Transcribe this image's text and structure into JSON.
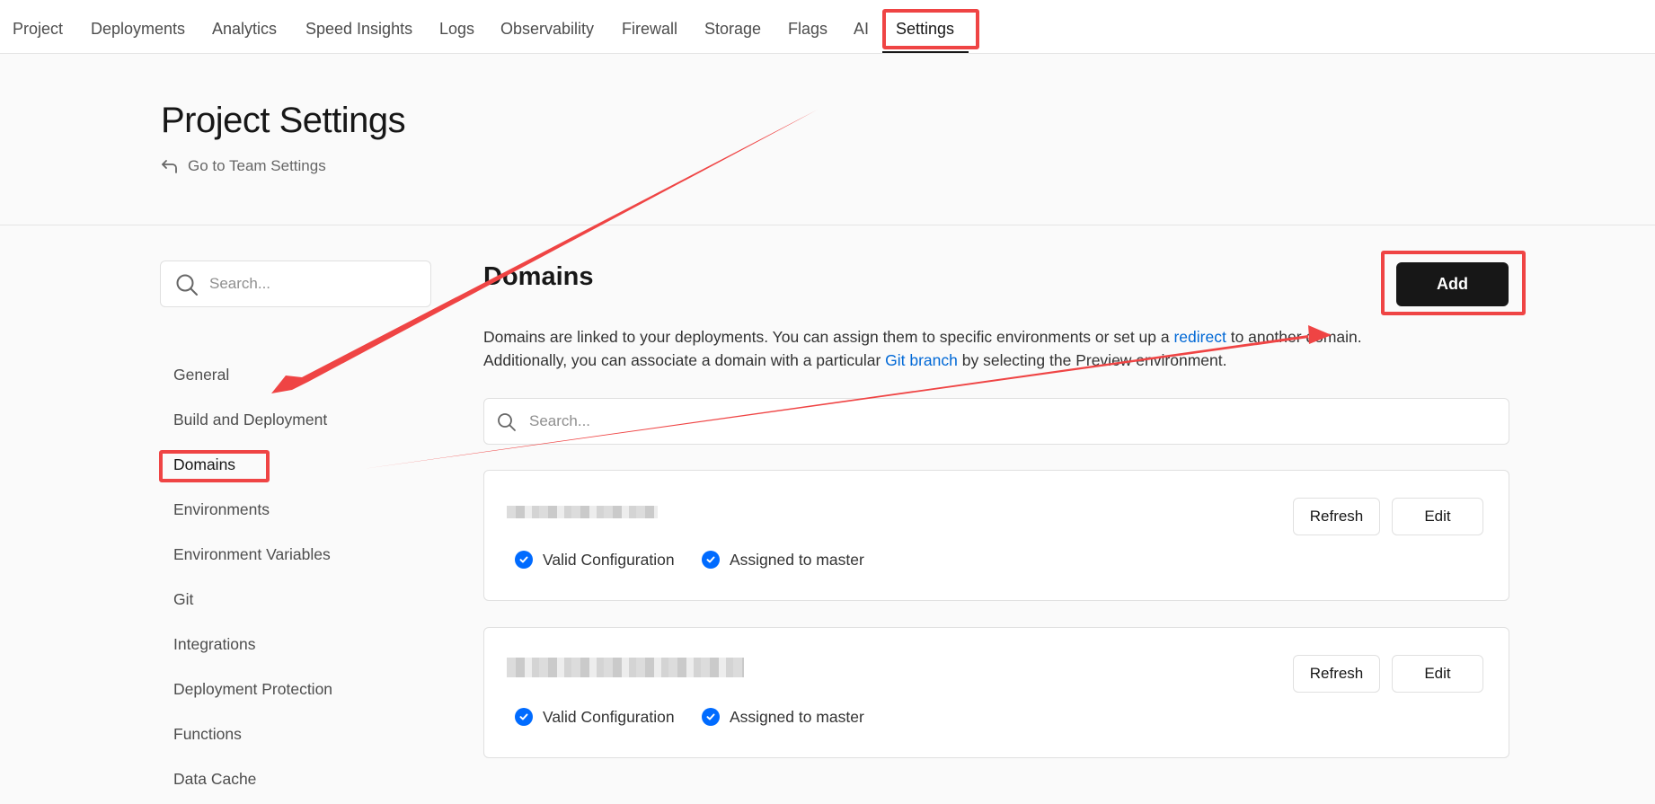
{
  "nav": {
    "tabs": [
      {
        "label": "Project"
      },
      {
        "label": "Deployments"
      },
      {
        "label": "Analytics"
      },
      {
        "label": "Speed Insights"
      },
      {
        "label": "Logs"
      },
      {
        "label": "Observability"
      },
      {
        "label": "Firewall"
      },
      {
        "label": "Storage"
      },
      {
        "label": "Flags"
      },
      {
        "label": "AI"
      },
      {
        "label": "Settings"
      }
    ],
    "active_tab": "Settings"
  },
  "header": {
    "title": "Project Settings",
    "team_link": "Go to Team Settings",
    "team_link_icon": "corner-up-left-icon"
  },
  "sidebar": {
    "search_placeholder": "Search...",
    "items": [
      {
        "label": "General"
      },
      {
        "label": "Build and Deployment"
      },
      {
        "label": "Domains"
      },
      {
        "label": "Environments"
      },
      {
        "label": "Environment Variables"
      },
      {
        "label": "Git"
      },
      {
        "label": "Integrations"
      },
      {
        "label": "Deployment Protection"
      },
      {
        "label": "Functions"
      },
      {
        "label": "Data Cache"
      }
    ],
    "active_item": "Domains"
  },
  "domains": {
    "title": "Domains",
    "add_label": "Add",
    "description": {
      "part1": "Domains are linked to your deployments. You can assign them to specific environments or set up a ",
      "link1": "redirect",
      "part2": " to another domain.",
      "part3": "Additionally, you can associate a domain with a particular ",
      "link2": "Git branch",
      "part4": " by selecting the Preview environment."
    },
    "search_placeholder": "Search...",
    "cards": [
      {
        "domain": "",
        "refresh_label": "Refresh",
        "edit_label": "Edit",
        "status_valid": "Valid Configuration",
        "status_assigned": "Assigned to master"
      },
      {
        "domain": "",
        "refresh_label": "Refresh",
        "edit_label": "Edit",
        "status_valid": "Valid Configuration",
        "status_assigned": "Assigned to master"
      }
    ]
  },
  "colors": {
    "accent": "#0068d6",
    "check": "#006bff",
    "annotation": "#ef4444",
    "primary_button": "#171717"
  }
}
